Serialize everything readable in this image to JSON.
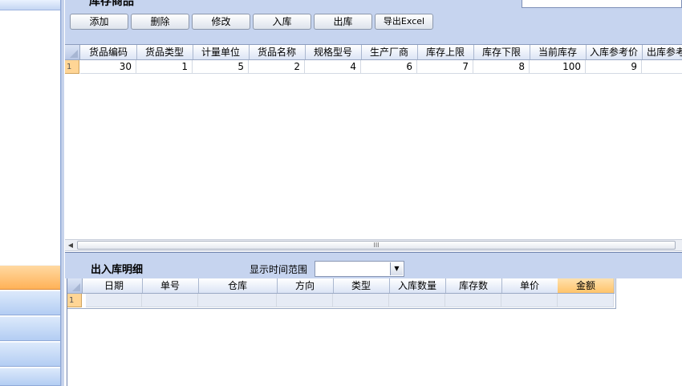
{
  "goods": {
    "title": "库存商品",
    "toolbar": {
      "add": "添加",
      "delete": "删除",
      "edit": "修改",
      "stock_in": "入库",
      "stock_out": "出库",
      "export": "导出Excel"
    },
    "columns": [
      "货品编码",
      "货品类型",
      "计量单位",
      "货品名称",
      "规格型号",
      "生产厂商",
      "库存上限",
      "库存下限",
      "当前库存",
      "入库参考价",
      "出库参考"
    ],
    "rows": [
      {
        "num": "1",
        "cells": [
          "30",
          "1",
          "5",
          "2",
          "4",
          "6",
          "7",
          "8",
          "100",
          "9",
          ""
        ]
      }
    ],
    "scroll_grip": "III"
  },
  "details": {
    "title": "出入库明细",
    "range_label": "显示时间范围",
    "range_value": "",
    "columns": [
      "日期",
      "单号",
      "仓库",
      "方向",
      "类型",
      "入库数量",
      "库存数",
      "单价",
      "金额"
    ],
    "rows": [
      {
        "num": "1"
      }
    ]
  },
  "colors": {
    "panel": "#c6d4ef",
    "row_header": "#ffd595",
    "nav_active": "#ffb257"
  }
}
